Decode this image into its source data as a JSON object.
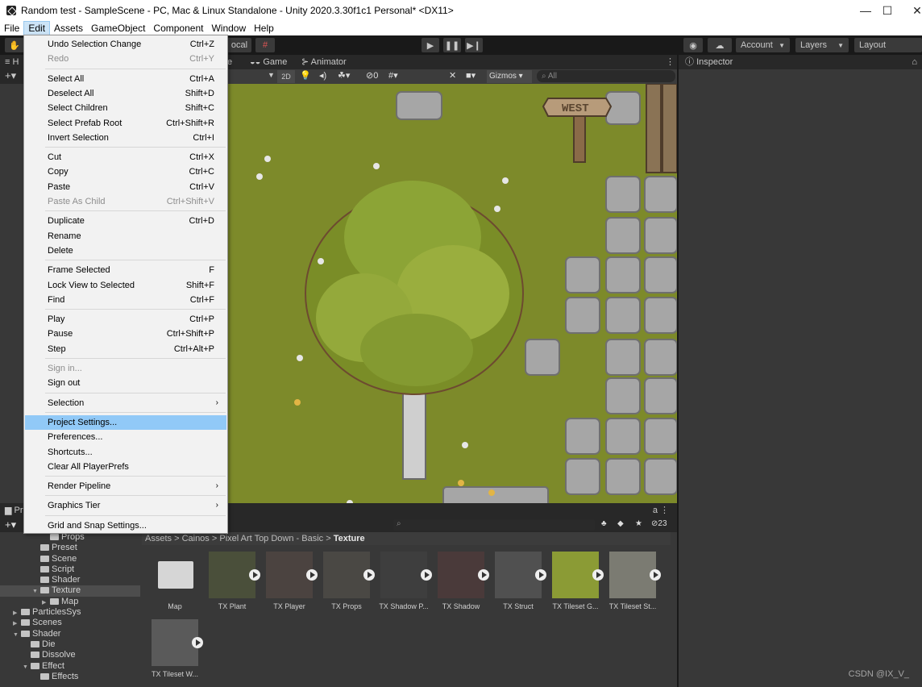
{
  "window": {
    "title": "Random test - SampleScene - PC, Mac & Linux Standalone - Unity 2020.3.30f1c1 Personal* <DX11>",
    "controls": {
      "minimize": "—",
      "maximize": "☐",
      "close": "✕"
    }
  },
  "menubar": {
    "items": [
      "File",
      "Edit",
      "Assets",
      "GameObject",
      "Component",
      "Window",
      "Help"
    ],
    "active": "Edit"
  },
  "toolbar": {
    "local_label": "ocal",
    "account_label": "Account",
    "layers_label": "Layers",
    "layout_label": "Layout"
  },
  "hierarchy": {
    "tab_label": "H"
  },
  "scene": {
    "tabs": [
      "e",
      "Game",
      "Animator"
    ],
    "mode_2d": "2D",
    "gizmos_label": "Gizmos",
    "search_placeholder": "All",
    "hidden_count": "0",
    "sign_text": "WEST"
  },
  "inspector": {
    "title": "Inspector"
  },
  "edit_menu": {
    "items": [
      {
        "label": "Undo Selection Change",
        "shortcut": "Ctrl+Z",
        "enabled": true
      },
      {
        "label": "Redo",
        "shortcut": "Ctrl+Y",
        "enabled": false
      },
      {
        "sep": true
      },
      {
        "label": "Select All",
        "shortcut": "Ctrl+A",
        "enabled": true
      },
      {
        "label": "Deselect All",
        "shortcut": "Shift+D",
        "enabled": true
      },
      {
        "label": "Select Children",
        "shortcut": "Shift+C",
        "enabled": true
      },
      {
        "label": "Select Prefab Root",
        "shortcut": "Ctrl+Shift+R",
        "enabled": true
      },
      {
        "label": "Invert Selection",
        "shortcut": "Ctrl+I",
        "enabled": true
      },
      {
        "sep": true
      },
      {
        "label": "Cut",
        "shortcut": "Ctrl+X",
        "enabled": true
      },
      {
        "label": "Copy",
        "shortcut": "Ctrl+C",
        "enabled": true
      },
      {
        "label": "Paste",
        "shortcut": "Ctrl+V",
        "enabled": true
      },
      {
        "label": "Paste As Child",
        "shortcut": "Ctrl+Shift+V",
        "enabled": false
      },
      {
        "sep": true
      },
      {
        "label": "Duplicate",
        "shortcut": "Ctrl+D",
        "enabled": true
      },
      {
        "label": "Rename",
        "shortcut": "",
        "enabled": true
      },
      {
        "label": "Delete",
        "shortcut": "",
        "enabled": true
      },
      {
        "sep": true
      },
      {
        "label": "Frame Selected",
        "shortcut": "F",
        "enabled": true
      },
      {
        "label": "Lock View to Selected",
        "shortcut": "Shift+F",
        "enabled": true
      },
      {
        "label": "Find",
        "shortcut": "Ctrl+F",
        "enabled": true
      },
      {
        "sep": true
      },
      {
        "label": "Play",
        "shortcut": "Ctrl+P",
        "enabled": true
      },
      {
        "label": "Pause",
        "shortcut": "Ctrl+Shift+P",
        "enabled": true
      },
      {
        "label": "Step",
        "shortcut": "Ctrl+Alt+P",
        "enabled": true
      },
      {
        "sep": true
      },
      {
        "label": "Sign in...",
        "shortcut": "",
        "enabled": false
      },
      {
        "label": "Sign out",
        "shortcut": "",
        "enabled": true
      },
      {
        "sep": true
      },
      {
        "label": "Selection",
        "shortcut": "",
        "submenu": true,
        "enabled": true
      },
      {
        "sep": true
      },
      {
        "label": "Project Settings...",
        "shortcut": "",
        "enabled": true,
        "highlighted": true
      },
      {
        "label": "Preferences...",
        "shortcut": "",
        "enabled": true
      },
      {
        "label": "Shortcuts...",
        "shortcut": "",
        "enabled": true
      },
      {
        "label": "Clear All PlayerPrefs",
        "shortcut": "",
        "enabled": true
      },
      {
        "sep": true
      },
      {
        "label": "Render Pipeline",
        "shortcut": "",
        "submenu": true,
        "enabled": true
      },
      {
        "sep": true
      },
      {
        "label": "Graphics Tier",
        "shortcut": "",
        "submenu": true,
        "enabled": true
      },
      {
        "sep": true
      },
      {
        "label": "Grid and Snap Settings...",
        "shortcut": "",
        "enabled": true
      }
    ]
  },
  "project": {
    "tab_label": "Pr",
    "hidden_count": "23",
    "breadcrumb": [
      "Assets",
      "Cainos",
      "Pixel Art Top Down - Basic",
      "Texture"
    ],
    "tree": [
      {
        "label": "Props",
        "depth": 4,
        "folder": true
      },
      {
        "label": "Preset",
        "depth": 3,
        "folder": true
      },
      {
        "label": "Scene",
        "depth": 3,
        "folder": true
      },
      {
        "label": "Script",
        "depth": 3,
        "folder": true
      },
      {
        "label": "Shader",
        "depth": 3,
        "folder": true
      },
      {
        "label": "Texture",
        "depth": 3,
        "folder": true,
        "open": true,
        "selected": true
      },
      {
        "label": "Map",
        "depth": 4,
        "folder": true,
        "collapsed": true
      },
      {
        "label": "ParticlesSys",
        "depth": 1,
        "folder": true,
        "collapsed": true
      },
      {
        "label": "Scenes",
        "depth": 1,
        "folder": true,
        "collapsed": true
      },
      {
        "label": "Shader",
        "depth": 1,
        "folder": true,
        "open": true
      },
      {
        "label": "Die",
        "depth": 2,
        "folder": true
      },
      {
        "label": "Dissolve",
        "depth": 2,
        "folder": true
      },
      {
        "label": "Effect",
        "depth": 2,
        "folder": true,
        "open": true
      },
      {
        "label": "Effects",
        "depth": 3,
        "folder": true
      }
    ],
    "assets": [
      {
        "label": "Map",
        "kind": "folder"
      },
      {
        "label": "TX Plant",
        "kind": "texture"
      },
      {
        "label": "TX Player",
        "kind": "texture"
      },
      {
        "label": "TX Props",
        "kind": "texture"
      },
      {
        "label": "TX Shadow P...",
        "kind": "texture"
      },
      {
        "label": "TX Shadow",
        "kind": "texture"
      },
      {
        "label": "TX Struct",
        "kind": "texture"
      },
      {
        "label": "TX Tileset G...",
        "kind": "texture"
      },
      {
        "label": "TX Tileset St...",
        "kind": "texture"
      },
      {
        "label": "TX Tileset W...",
        "kind": "texture"
      }
    ]
  },
  "watermark": "CSDN @IX_V_",
  "colors": {
    "grass": "#7d8a2a",
    "menu_highlight": "#91c9f7",
    "editor_dark": "#383838"
  }
}
